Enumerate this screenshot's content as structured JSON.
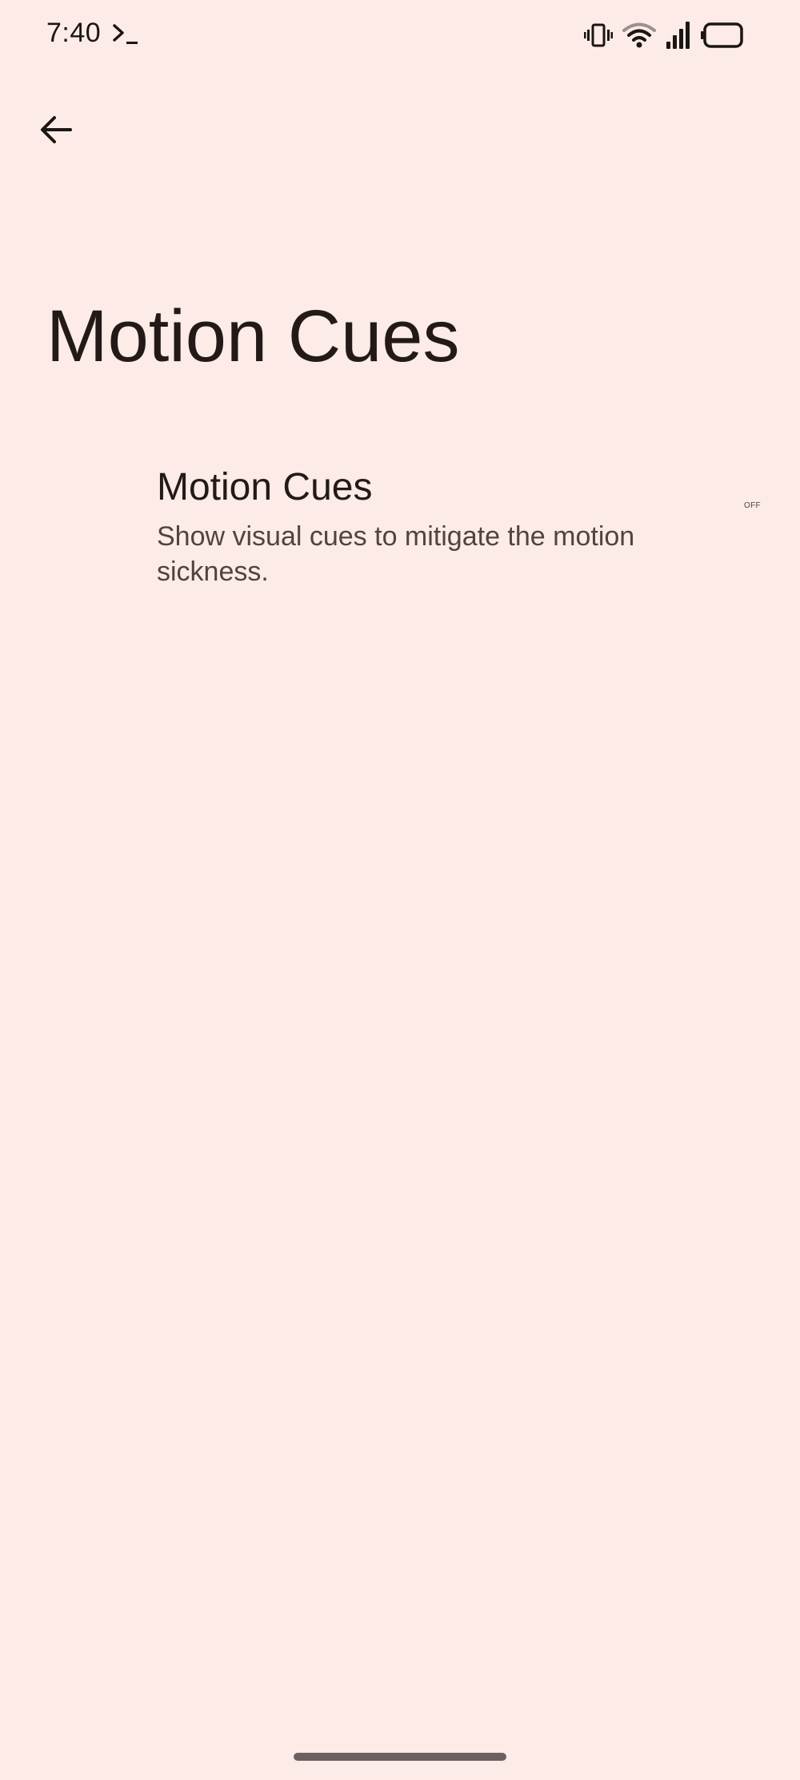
{
  "status_bar": {
    "time": "7:40",
    "icons": [
      "terminal-icon",
      "vibrate-icon",
      "wifi-icon",
      "cell-signal-icon",
      "battery-icon"
    ]
  },
  "toolbar": {
    "back_icon": "arrow-left-icon"
  },
  "page": {
    "title": "Motion Cues"
  },
  "setting": {
    "title": "Motion Cues",
    "summary": "Show visual cues to mitigate the motion sickness.",
    "toggle_state": "OFF"
  },
  "colors": {
    "background": "#fcebe6",
    "text_primary": "#231a18",
    "text_secondary": "#52433f",
    "home_indicator": "#6c6160"
  }
}
